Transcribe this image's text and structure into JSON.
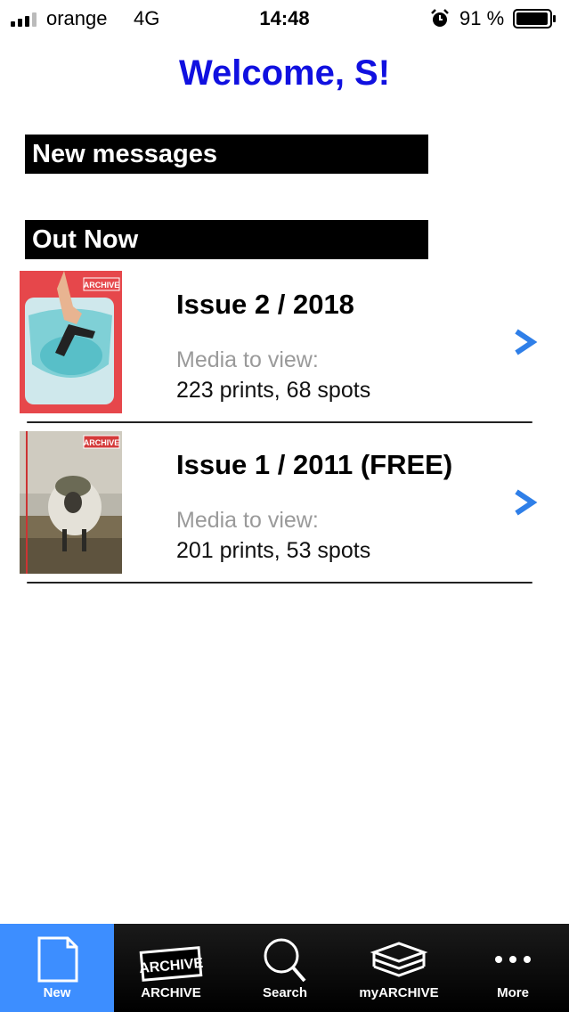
{
  "status_bar": {
    "carrier": "orange",
    "network": "4G",
    "time": "14:48",
    "battery": "91 %"
  },
  "welcome": "Welcome, S!",
  "sections": {
    "new_messages": "New messages",
    "out_now": "Out Now"
  },
  "issues": [
    {
      "title": "Issue 2 / 2018",
      "media_label": "Media to view:",
      "media_count": "223 prints, 68 spots",
      "cover_logo": "ARCHIVE"
    },
    {
      "title": "Issue 1 / 2011 (FREE)",
      "media_label": "Media to view:",
      "media_count": "201 prints, 53 spots",
      "cover_logo": "ARCHIVE"
    }
  ],
  "tab_bar": {
    "tabs": [
      {
        "label": "New",
        "icon": "document-icon",
        "active": true
      },
      {
        "label": "ARCHIVE",
        "icon": "archive-logo-icon",
        "logo_text": "ARCHIVE"
      },
      {
        "label": "Search",
        "icon": "search-icon"
      },
      {
        "label": "myARCHIVE",
        "icon": "stack-icon"
      },
      {
        "label": "More",
        "icon": "more-icon"
      }
    ]
  },
  "colors": {
    "welcome": "#1010e0",
    "accent": "#3d8eff",
    "chevron": "#2f7fe8"
  }
}
